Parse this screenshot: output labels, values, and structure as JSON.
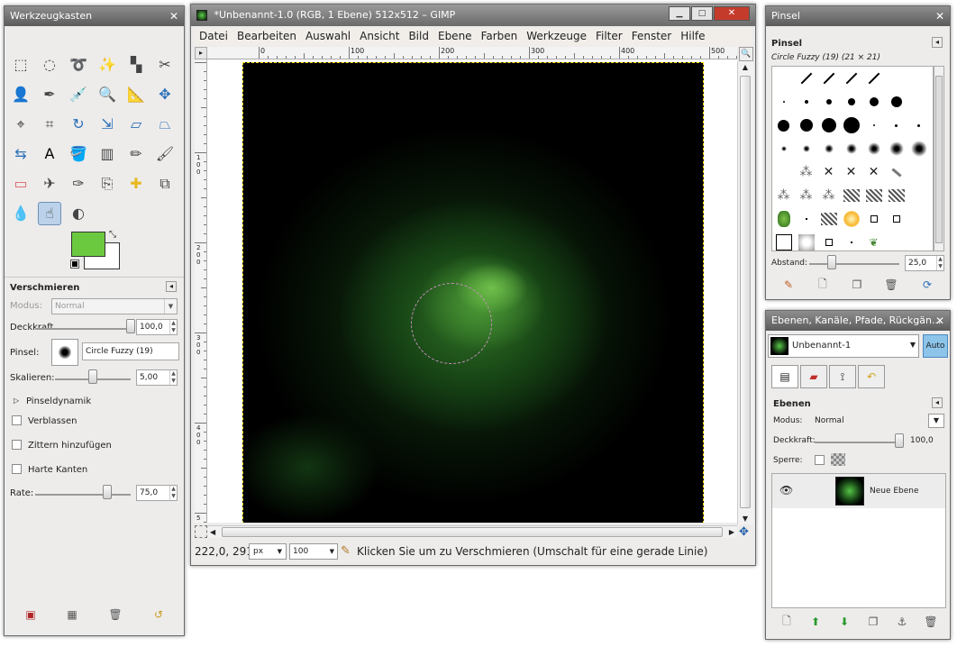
{
  "toolbox": {
    "title": "Werkzeugkasten",
    "fg_color": "#6bc93f",
    "bg_color": "#ffffff",
    "tools": [
      "rect-select",
      "ellipse-select",
      "free-select",
      "fuzzy-select",
      "color-select",
      "scissors",
      "foreground-select",
      "paths",
      "color-picker",
      "zoom",
      "measure",
      "move",
      "align",
      "crop",
      "rotate",
      "scale",
      "shear",
      "perspective",
      "flip",
      "text",
      "bucket-fill",
      "blend",
      "pencil",
      "paintbrush",
      "eraser",
      "airbrush",
      "ink",
      "clone",
      "heal",
      "perspective-clone",
      "blur",
      "smudge",
      "dodge-burn"
    ],
    "options": {
      "title": "Verschmieren",
      "mode_label": "Modus:",
      "mode_value": "Normal",
      "opacity_label": "Deckkraft",
      "opacity_value": "100,0",
      "opacity_fraction": 1.0,
      "brush_label": "Pinsel:",
      "brush_value": "Circle Fuzzy (19)",
      "scale_label": "Skalieren:",
      "scale_value": "5,00",
      "scale_fraction": 0.5,
      "dynamics_label": "Pinseldynamik",
      "fade_label": "Verblassen",
      "jitter_label": "Zittern hinzufügen",
      "hard_label": "Harte Kanten",
      "rate_label": "Rate:",
      "rate_value": "75,0",
      "rate_fraction": 0.75
    }
  },
  "image_window": {
    "title": "*Unbenannt-1.0 (RGB, 1 Ebene) 512x512 – GIMP",
    "menu": [
      "Datei",
      "Bearbeiten",
      "Auswahl",
      "Ansicht",
      "Bild",
      "Ebene",
      "Farben",
      "Werkzeuge",
      "Filter",
      "Fenster",
      "Hilfe"
    ],
    "ruler_h": [
      "0",
      "100",
      "200",
      "300",
      "400",
      "500"
    ],
    "ruler_v": [
      "1\n0\n0",
      "2\n0\n0",
      "3\n0\n0",
      "4\n0\n0",
      "5"
    ],
    "coords": "222,0, 291,0",
    "unit": "px",
    "zoom": "100",
    "status": "Klicken Sie um zu Verschmieren (Umschalt für eine gerade Linie)"
  },
  "brushes": {
    "title": "Pinsel",
    "panel_title": "Pinsel",
    "selected": "Circle Fuzzy (19) (21 × 21)",
    "spacing_label": "Abstand:",
    "spacing_value": "25,0",
    "spacing_fraction": 0.25
  },
  "layers": {
    "title": "Ebenen, Kanäle, Pfade, Rückgän...",
    "image_name": "Unbenannt-1",
    "auto_label": "Auto",
    "panel_title": "Ebenen",
    "mode_label": "Modus:",
    "mode_value": "Normal",
    "opacity_label": "Deckkraft:",
    "opacity_value": "100,0",
    "opacity_fraction": 1.0,
    "lock_label": "Sperre:",
    "layer_name": "Neue Ebene"
  }
}
